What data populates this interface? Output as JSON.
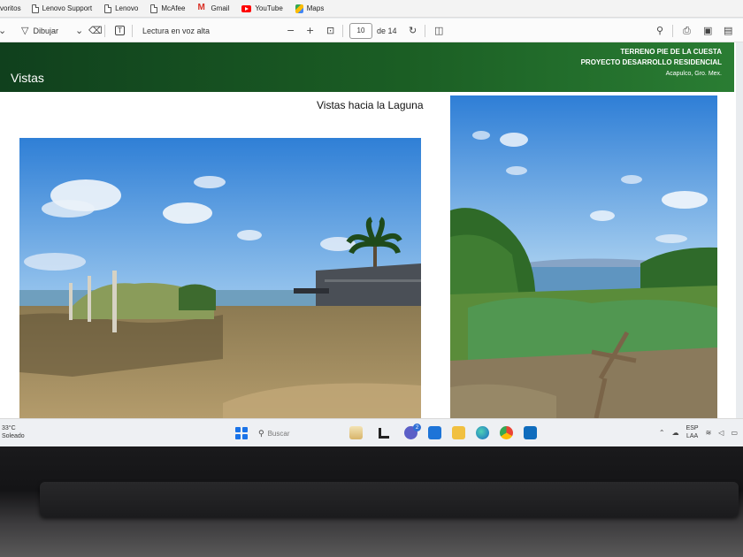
{
  "bookmarks": {
    "first_partial": "voritos",
    "items": [
      {
        "label": "Lenovo Support",
        "icon": "document-icon"
      },
      {
        "label": "Lenovo",
        "icon": "document-icon"
      },
      {
        "label": "McAfee",
        "icon": "document-icon"
      },
      {
        "label": "Gmail",
        "icon": "gmail-icon"
      },
      {
        "label": "YouTube",
        "icon": "youtube-icon"
      },
      {
        "label": "Maps",
        "icon": "maps-icon"
      }
    ]
  },
  "pdf_toolbar": {
    "draw_label": "Dibujar",
    "read_aloud_label": "Lectura en voz alta",
    "page_current": "10",
    "page_total": "de 14"
  },
  "slide": {
    "title": "Vistas",
    "header_line1": "TERRENO PIE DE LA CUESTA",
    "header_line2": "PROYECTO DESARROLLO RESIDENCIAL",
    "header_line3": "Acapulco, Gro. Mex.",
    "caption": "Vistas hacia la Laguna",
    "header_color": "#1b5e24"
  },
  "taskbar": {
    "temperature": "33°C",
    "weather": "Soleado",
    "search_placeholder": "Buscar",
    "chat_badge": "2",
    "lang_line1": "ESP",
    "lang_line2": "LAA"
  }
}
